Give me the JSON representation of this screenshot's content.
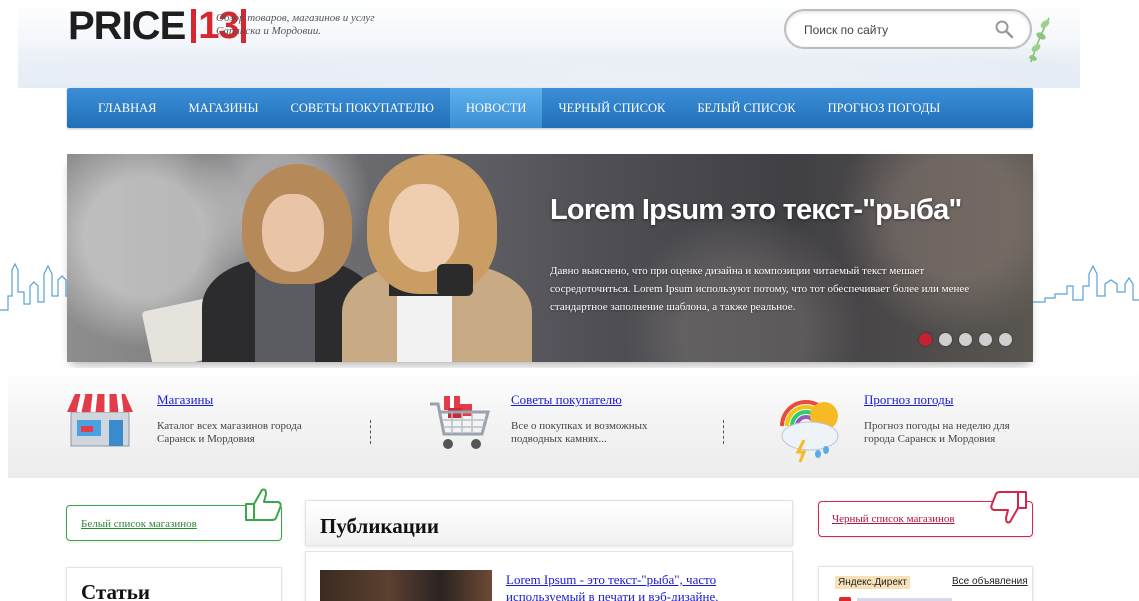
{
  "brand": {
    "logo_word": "PRICE",
    "logo_number": "13",
    "tagline": "Обзор товаров, магазинов и услуг Саранска и Мордовии."
  },
  "search": {
    "placeholder": "Поиск по сайту"
  },
  "nav": {
    "items": [
      {
        "label": "Главная",
        "active": false
      },
      {
        "label": "Магазины",
        "active": false
      },
      {
        "label": "Советы покупателю",
        "active": false
      },
      {
        "label": "Новости",
        "active": true
      },
      {
        "label": "Черный список",
        "active": false
      },
      {
        "label": "Белый список",
        "active": false
      },
      {
        "label": "Прогноз погоды",
        "active": false
      }
    ]
  },
  "slider": {
    "title": "Lorem Ipsum это текст-\"рыба\"",
    "text": "Давно выяснено, что при оценке дизайна и композиции читаемый текст мешает сосредоточиться. Lorem Ipsum используют потому, что тот обеспечивает более или менее стандартное заполнение шаблона, а также реальное.",
    "dots_count": 5,
    "active_dot": 1
  },
  "features": [
    {
      "title": "Магазины",
      "text": "Каталог всех магазинов города Саранск и Мордовия",
      "icon": "shop-icon"
    },
    {
      "title": "Советы покупателю",
      "text": "Все о покупках и возможных подводных камнях...",
      "icon": "shopping-cart-icon"
    },
    {
      "title": "Прогноз погоды",
      "text": "Прогноз погоды на неделю для города Саранск и Мордовия",
      "icon": "weather-icon"
    }
  ],
  "whitelist": {
    "label": "Белый список магазинов",
    "icon": "thumbs-up-icon",
    "accent": "#3aa64a"
  },
  "blacklist": {
    "label": "Черный список магазинов",
    "icon": "thumbs-down-icon",
    "accent": "#d3264a"
  },
  "publications": {
    "title": "Публикации",
    "items": [
      {
        "link": "Lorem Ipsum - это текст-\"рыба\", часто используемый в печати и вэб-дизайне."
      }
    ]
  },
  "articles": {
    "title": "Статьи"
  },
  "ads": {
    "label": "Яндекс.Директ",
    "all_link": "Все объявления"
  },
  "colors": {
    "nav": "#2a7dc8",
    "nav_active": "#4aa1e2",
    "link": "#1a1ad6",
    "dot_active": "#c62133"
  }
}
